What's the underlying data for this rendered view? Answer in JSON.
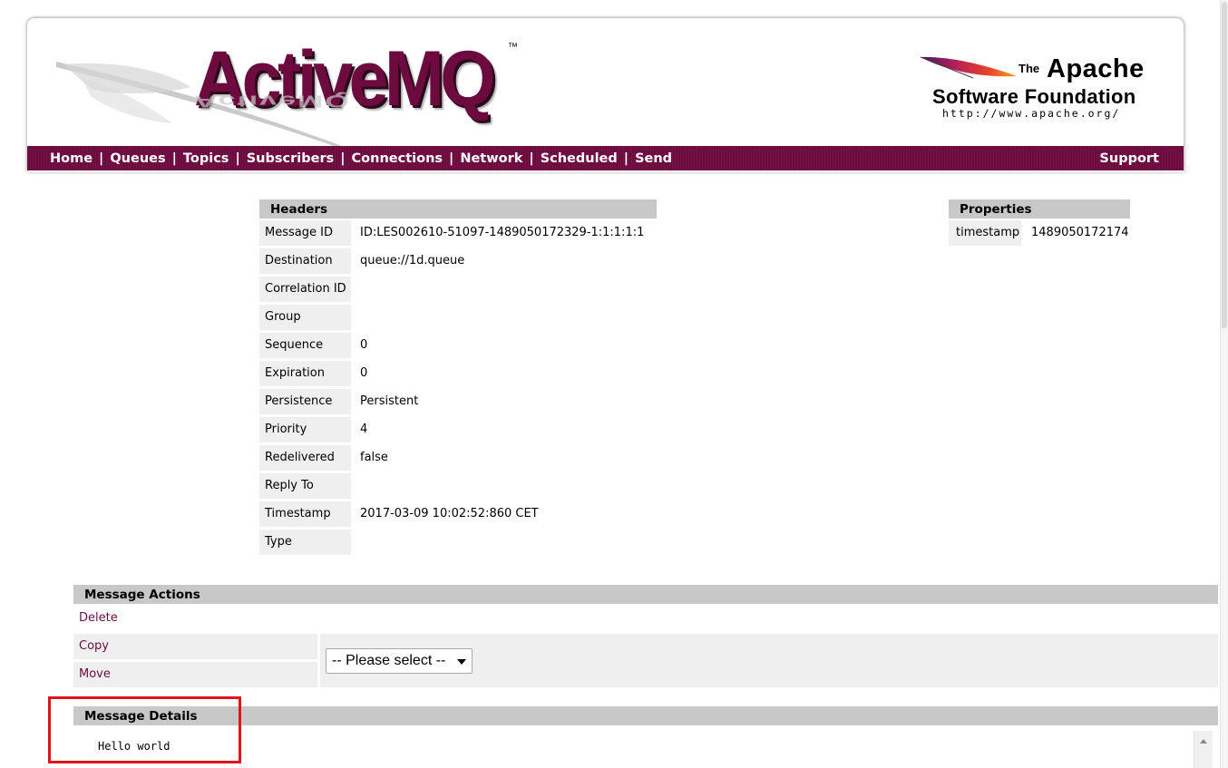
{
  "brand": {
    "product": "ActiveMQ",
    "tm": "™",
    "apache_the": "The",
    "apache_name": "Apache",
    "apache_foundation": "Software Foundation",
    "apache_url": "http://www.apache.org/"
  },
  "nav": {
    "items": [
      "Home",
      "Queues",
      "Topics",
      "Subscribers",
      "Connections",
      "Network",
      "Scheduled",
      "Send"
    ],
    "separator": "|",
    "support": "Support"
  },
  "headers": {
    "title": "Headers",
    "rows": [
      {
        "label": "Message ID",
        "value": "ID:LES002610-51097-1489050172329-1:1:1:1:1"
      },
      {
        "label": "Destination",
        "value": "queue://1d.queue"
      },
      {
        "label": "Correlation ID",
        "value": ""
      },
      {
        "label": "Group",
        "value": ""
      },
      {
        "label": "Sequence",
        "value": "0"
      },
      {
        "label": "Expiration",
        "value": "0"
      },
      {
        "label": "Persistence",
        "value": "Persistent"
      },
      {
        "label": "Priority",
        "value": "4"
      },
      {
        "label": "Redelivered",
        "value": "false"
      },
      {
        "label": "Reply To",
        "value": ""
      },
      {
        "label": "Timestamp",
        "value": "2017-03-09 10:02:52:860 CET"
      },
      {
        "label": "Type",
        "value": ""
      }
    ]
  },
  "properties": {
    "title": "Properties",
    "rows": [
      {
        "label": "timestamp",
        "value": "1489050172174"
      }
    ]
  },
  "actions": {
    "title": "Message Actions",
    "delete": "Delete",
    "copy": "Copy",
    "move": "Move",
    "select_value": "-- Please select --"
  },
  "details": {
    "title": "Message Details",
    "body": "Hello world"
  },
  "colors": {
    "brand": "#6d0b3f",
    "section_header": "#c8c8c8",
    "label_bg": "#efefef",
    "highlight": "#e0141a"
  }
}
